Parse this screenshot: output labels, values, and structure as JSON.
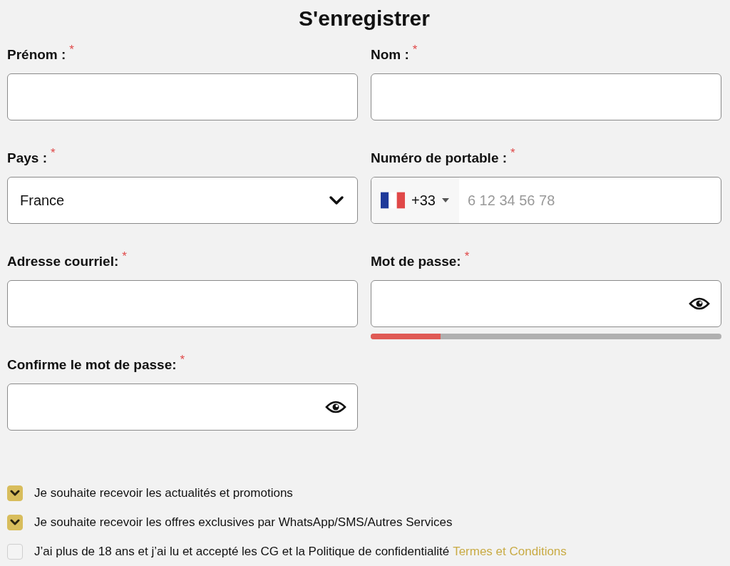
{
  "title": "S'enregistrer",
  "fields": [
    {
      "kind": "text",
      "label": "Prénom :",
      "required_mark": "*"
    },
    {
      "kind": "text",
      "label": "Nom :",
      "required_mark": "*"
    },
    {
      "kind": "select",
      "label": "Pays :",
      "required_mark": "*",
      "value": "France"
    },
    {
      "kind": "phone",
      "label": "Numéro de portable :",
      "required_mark": "*",
      "dial_code": "+33",
      "placeholder": "6 12 34 56 78"
    },
    {
      "kind": "text",
      "label": "Adresse courriel:",
      "required_mark": "*"
    },
    {
      "kind": "password",
      "label": "Mot de passe:",
      "required_mark": "*",
      "strength": {
        "level": 0.2
      }
    },
    {
      "kind": "password",
      "label": "Confirme le mot de passe:",
      "required_mark": "*"
    }
  ],
  "checkboxes": [
    {
      "label": "Je souhaite recevoir les actualités et promotions",
      "checked": true
    },
    {
      "label": "Je souhaite recevoir les offres exclusives par WhatsApp/SMS/Autres Services",
      "checked": true
    },
    {
      "label": "J’ai plus de 18 ans et j’ai lu et accepté les CG et la Politique de confidentialité",
      "checked": false,
      "link": "Termes et Conditions"
    }
  ]
}
